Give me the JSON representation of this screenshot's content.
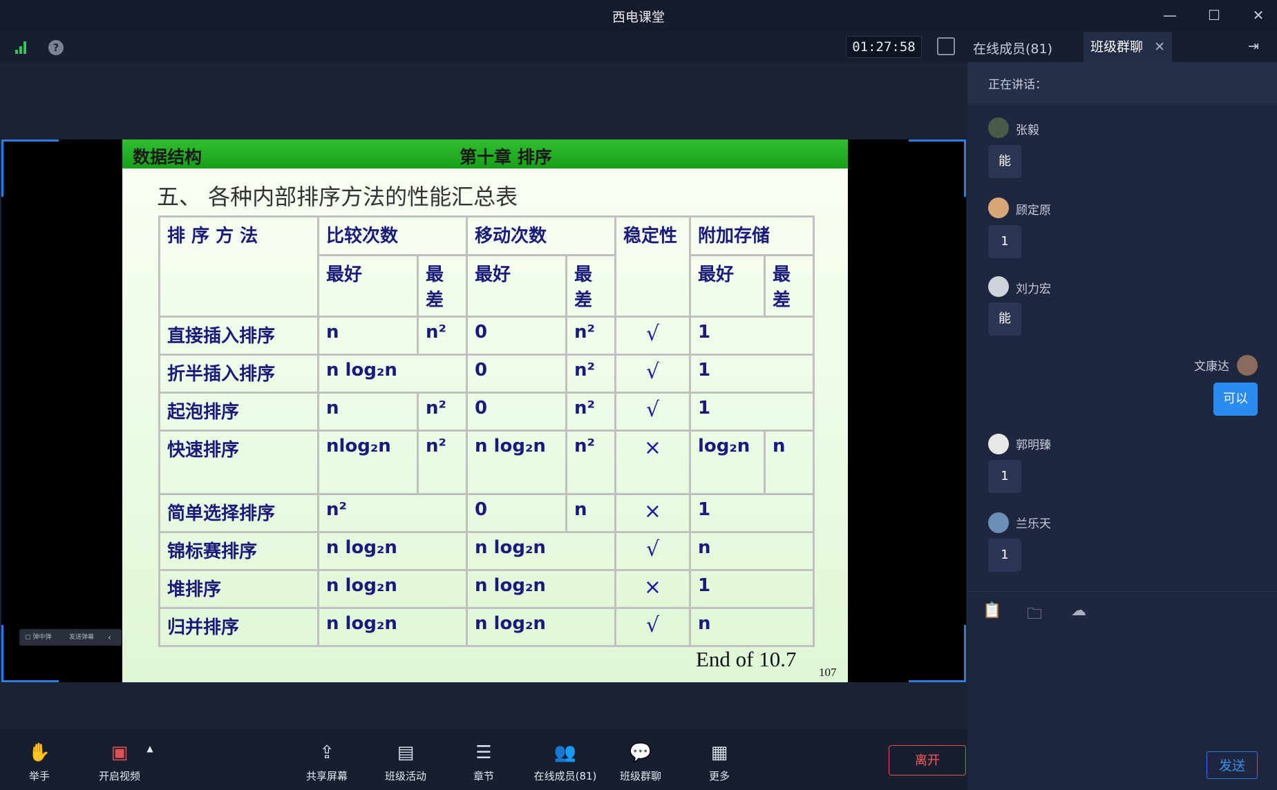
{
  "window": {
    "title": "西电课堂",
    "minimize": "—",
    "maximize": "☐",
    "close": "✕"
  },
  "topbar": {
    "timer": "01:27:58"
  },
  "slide": {
    "course": "数据结构",
    "chapter": "第十章 排序",
    "heading": "五、 各种内部排序方法的性能汇总表",
    "headers": {
      "method": "排 序 方 法",
      "compare": "比较次数",
      "move": "移动次数",
      "stable": "稳定性",
      "storage": "附加存储",
      "best": "最好",
      "worst": "最差"
    },
    "rows": [
      {
        "name": "直接插入排序",
        "cmp_best": "n",
        "cmp_worst": "n²",
        "mov_best": "0",
        "mov_worst": "n²",
        "stable": "√",
        "sto_best": "1",
        "sto_worst": ""
      },
      {
        "name": "折半插入排序",
        "cmp_best": "n log₂n",
        "cmp_worst": "",
        "mov_best": "0",
        "mov_worst": "n²",
        "stable": "√",
        "sto_best": "1",
        "sto_worst": ""
      },
      {
        "name": "起泡排序",
        "cmp_best": "n",
        "cmp_worst": "n²",
        "mov_best": "0",
        "mov_worst": "n²",
        "stable": "√",
        "sto_best": "1",
        "sto_worst": ""
      },
      {
        "name": "快速排序",
        "cmp_best": "nlog₂n",
        "cmp_worst": "n²",
        "mov_best": "n log₂n",
        "mov_worst": "n²",
        "stable": "×",
        "sto_best": "log₂n",
        "sto_worst": "n"
      },
      {
        "name": "简单选择排序",
        "cmp_best": "n²",
        "cmp_worst": "",
        "mov_best": "0",
        "mov_worst": "n",
        "stable": "×",
        "sto_best": "1",
        "sto_worst": ""
      },
      {
        "name": "锦标赛排序",
        "cmp_best": "n log₂n",
        "cmp_worst": "",
        "mov_best": "n log₂n",
        "mov_worst": "",
        "stable": "√",
        "sto_best": "n",
        "sto_worst": ""
      },
      {
        "name": "堆排序",
        "cmp_best": "n log₂n",
        "cmp_worst": "",
        "mov_best": "n log₂n",
        "mov_worst": "",
        "stable": "×",
        "sto_best": "1",
        "sto_worst": ""
      },
      {
        "name": "归并排序",
        "cmp_best": "n log₂n",
        "cmp_worst": "",
        "mov_best": "n log₂n",
        "mov_worst": "",
        "stable": "√",
        "sto_best": "n",
        "sto_worst": ""
      }
    ],
    "end_note": "End of 10.7",
    "page_number": "107"
  },
  "danmu": {
    "toggle": "▢ 弹中弹",
    "send": "发送弹幕",
    "collapse": "‹"
  },
  "toolbar": {
    "raise_hand": "举手",
    "video": "开启视频",
    "share": "共享屏幕",
    "activity": "班级活动",
    "chapter": "章节",
    "members": "在线成员(81)",
    "chat": "班级群聊",
    "more": "更多",
    "leave": "离开"
  },
  "sidebar": {
    "tab_members": "在线成员(81)",
    "tab_chat": "班级群聊",
    "speaking_label": "正在讲话：",
    "messages": [
      {
        "sender": "张毅",
        "text": "能"
      },
      {
        "sender": "顾定原",
        "text": "1"
      },
      {
        "sender": "刘力宏",
        "text": "能"
      },
      {
        "sender": "文康达",
        "text": "可以"
      },
      {
        "sender": "郭明臻",
        "text": "1"
      },
      {
        "sender": "兰乐天",
        "text": "1"
      }
    ],
    "send_label": "发送",
    "icons": [
      "announcement-icon",
      "folder-icon",
      "cloud-icon"
    ]
  }
}
